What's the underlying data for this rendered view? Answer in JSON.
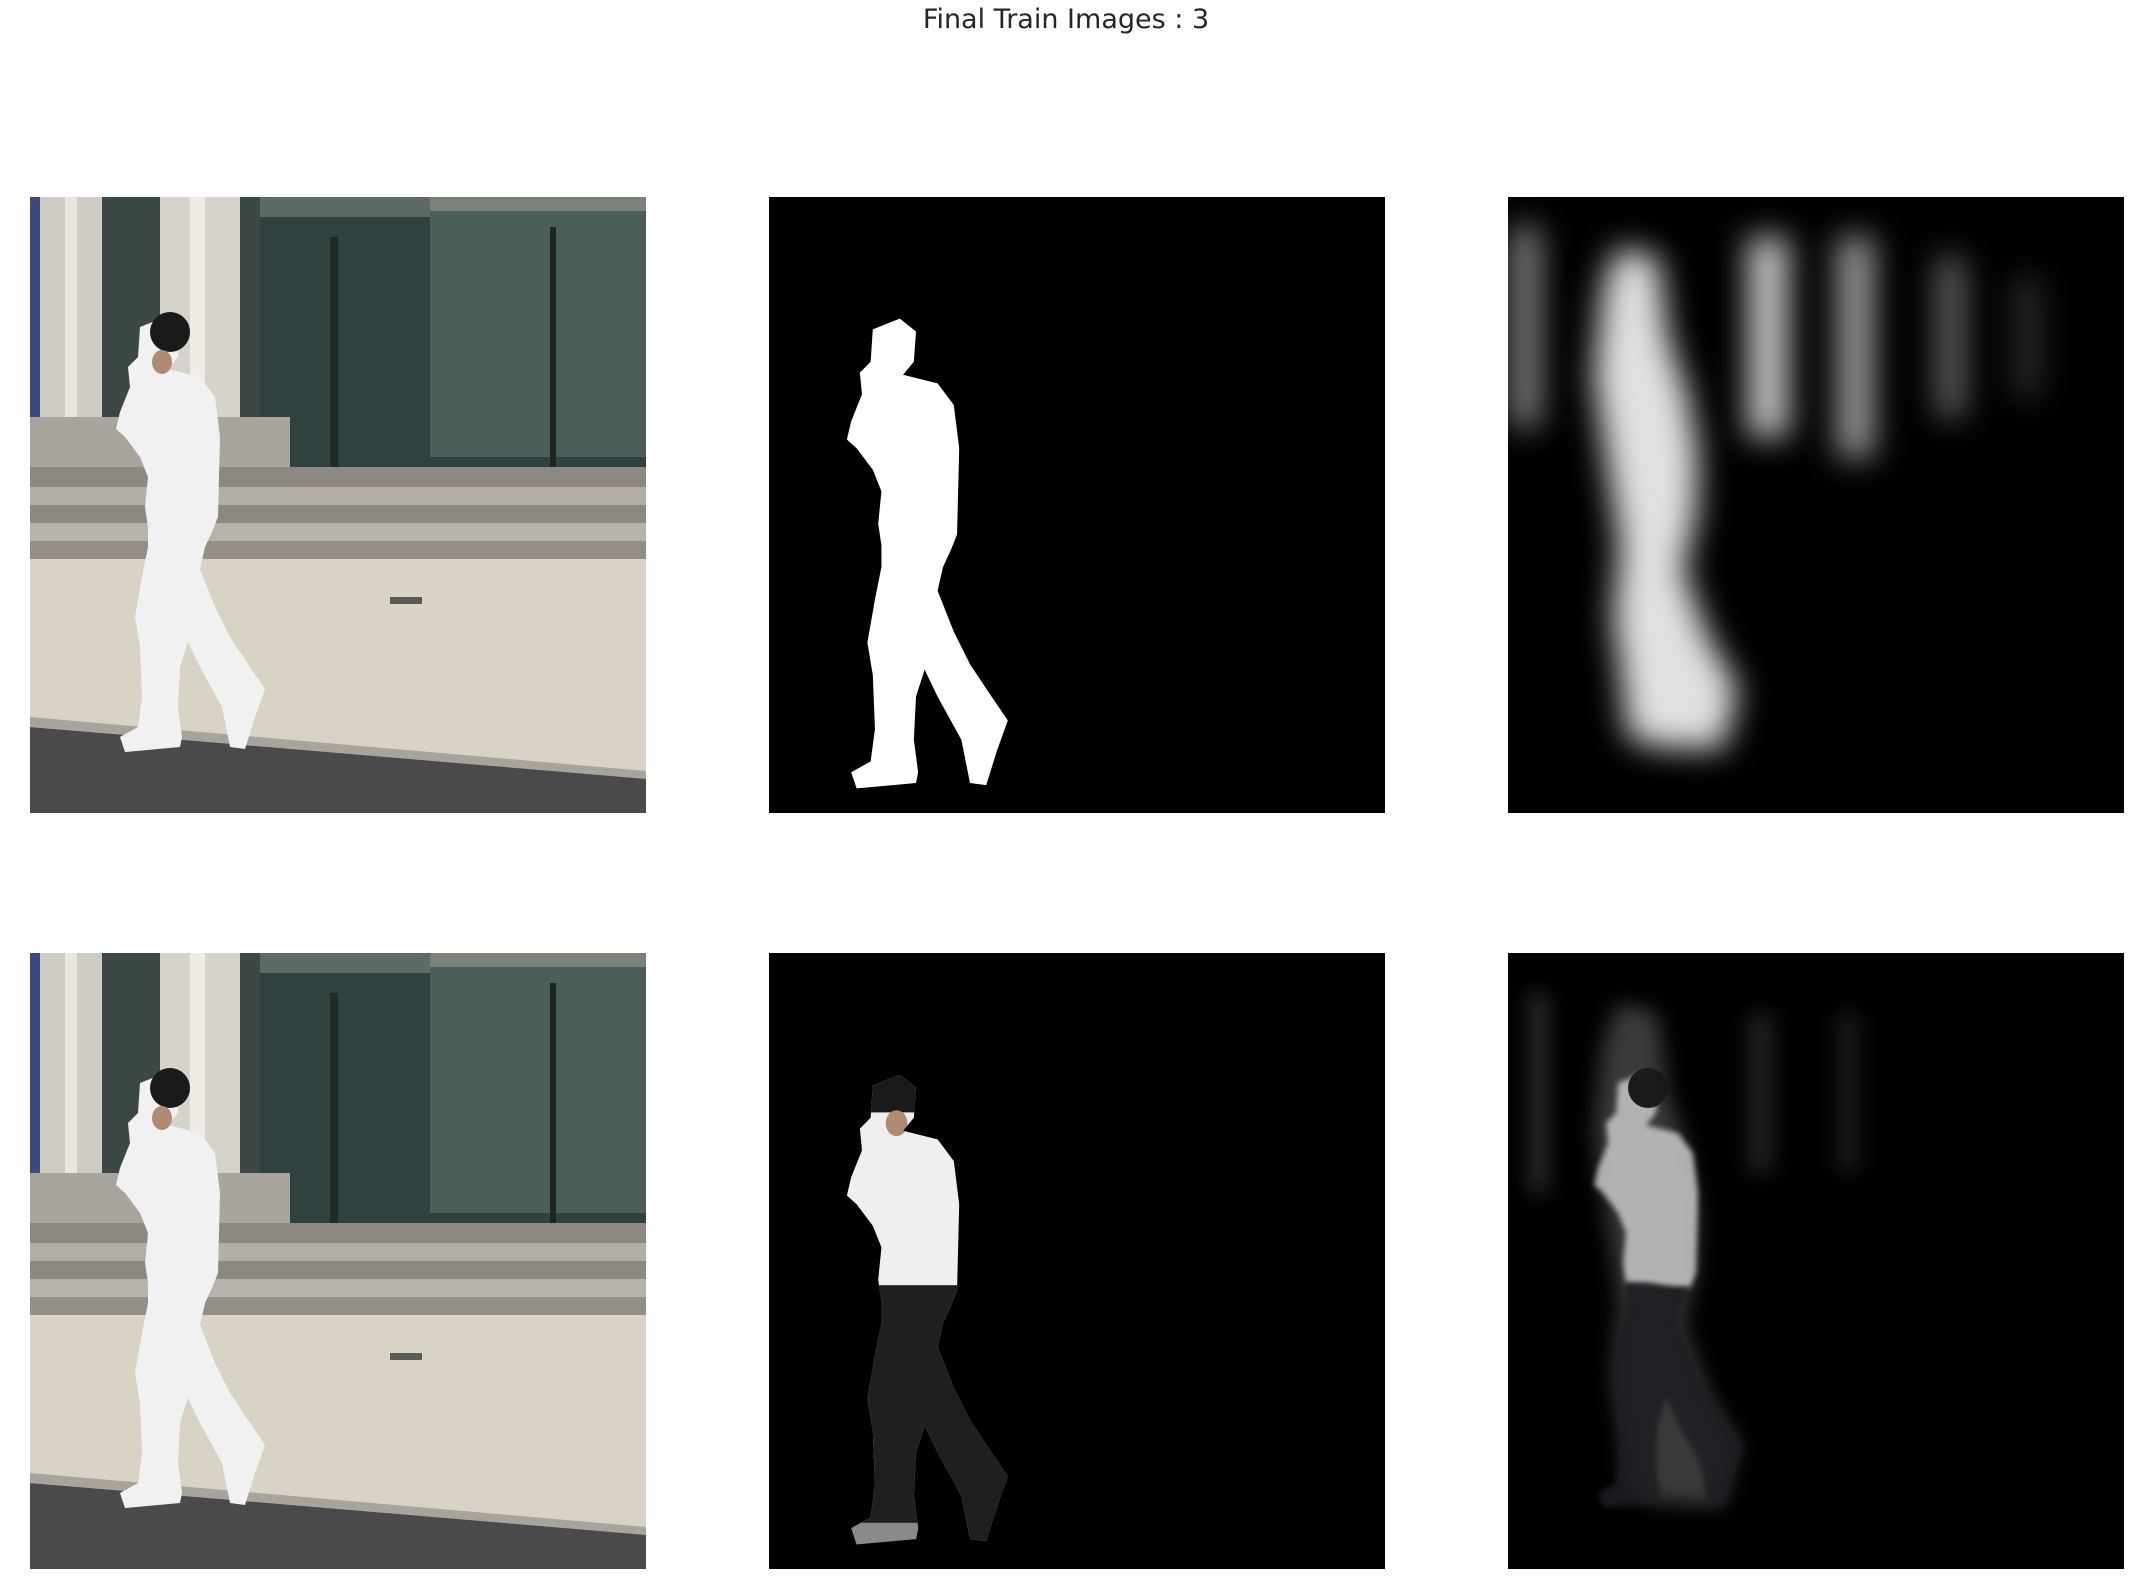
{
  "figure": {
    "title": "Final Train Images : 3"
  },
  "panels": [
    {
      "row": 1,
      "col": 1,
      "content": "input photo"
    },
    {
      "row": 1,
      "col": 2,
      "content": "ground-truth mask"
    },
    {
      "row": 1,
      "col": 3,
      "content": "predicted mask"
    },
    {
      "row": 2,
      "col": 1,
      "content": "input photo"
    },
    {
      "row": 2,
      "col": 2,
      "content": "photo masked by ground truth"
    },
    {
      "row": 2,
      "col": 3,
      "content": "photo masked by prediction"
    }
  ]
}
